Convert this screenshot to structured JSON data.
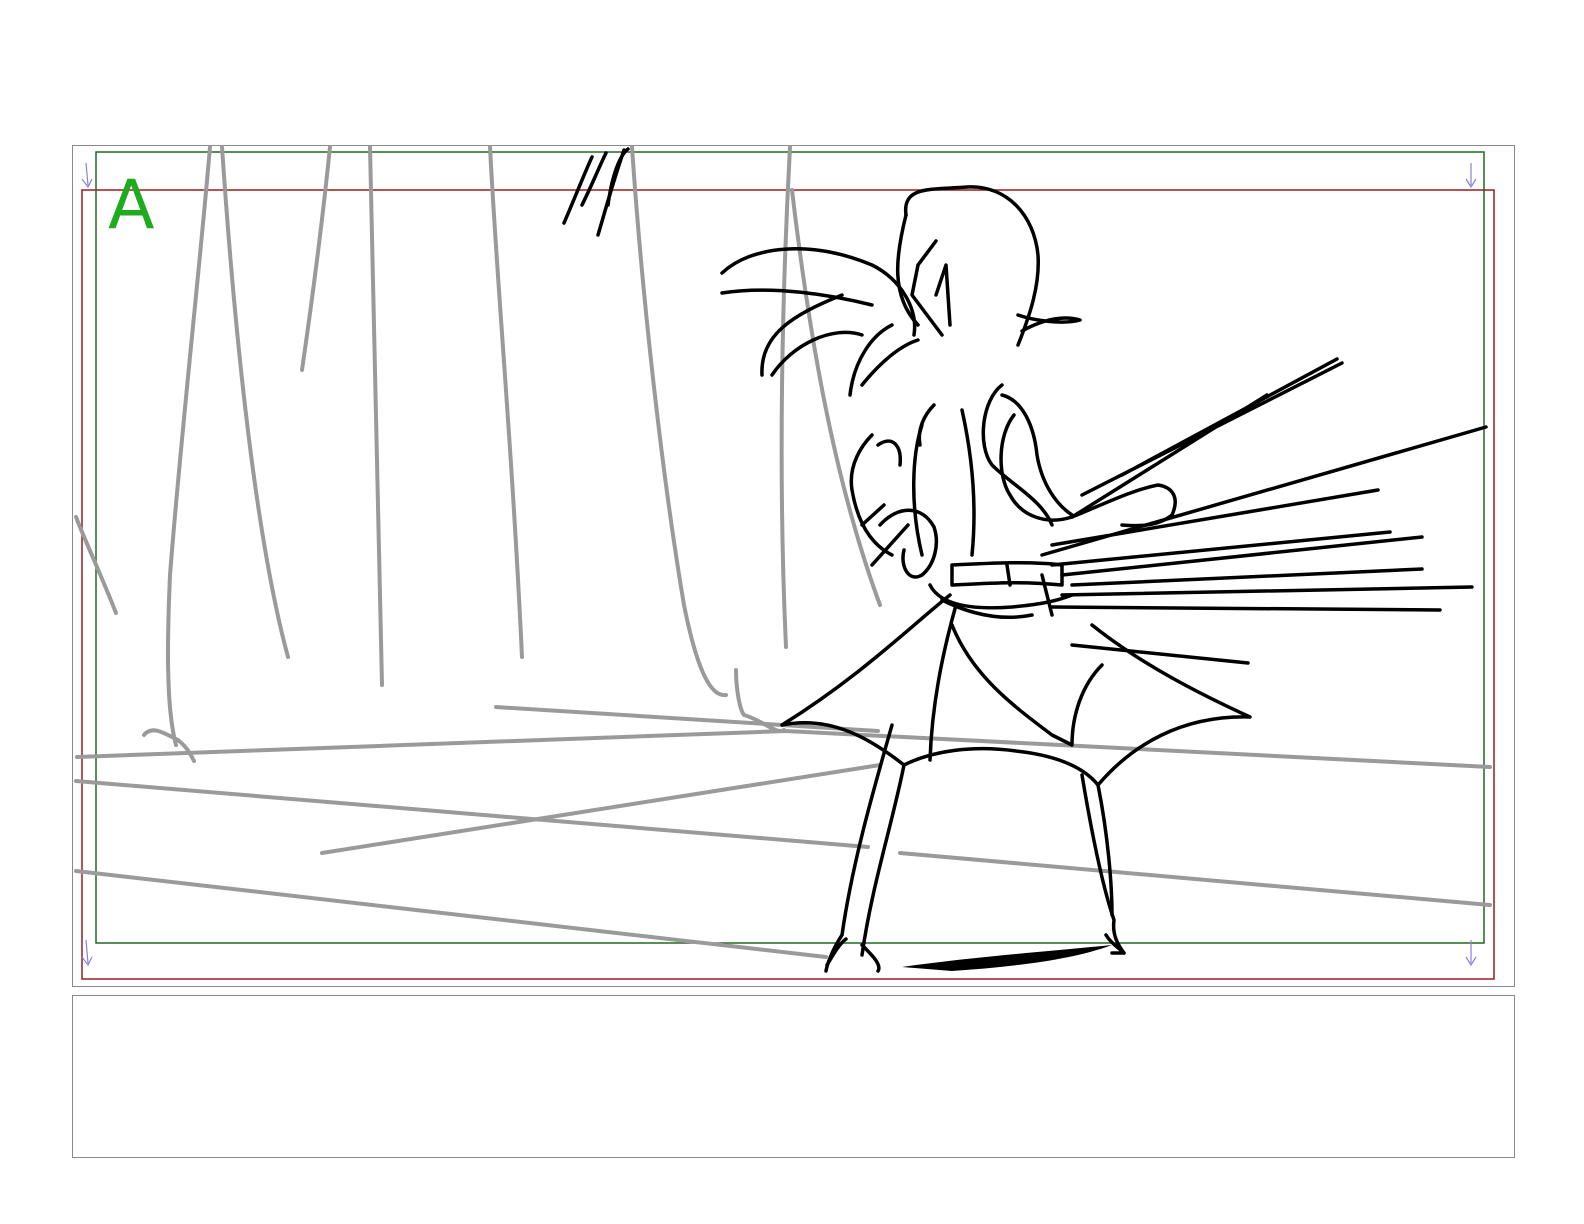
{
  "panel": {
    "label": "A",
    "label_color": "#1faa1f"
  },
  "guides": {
    "safe_area_color": "#1e6b1e",
    "action_area_color": "#9b1c1c",
    "corner_marker_color": "#8a7fd6"
  },
  "sketch": {
    "background_line_color": "#9a9a9a",
    "character_line_color": "#000000"
  },
  "notes": {
    "text": ""
  }
}
